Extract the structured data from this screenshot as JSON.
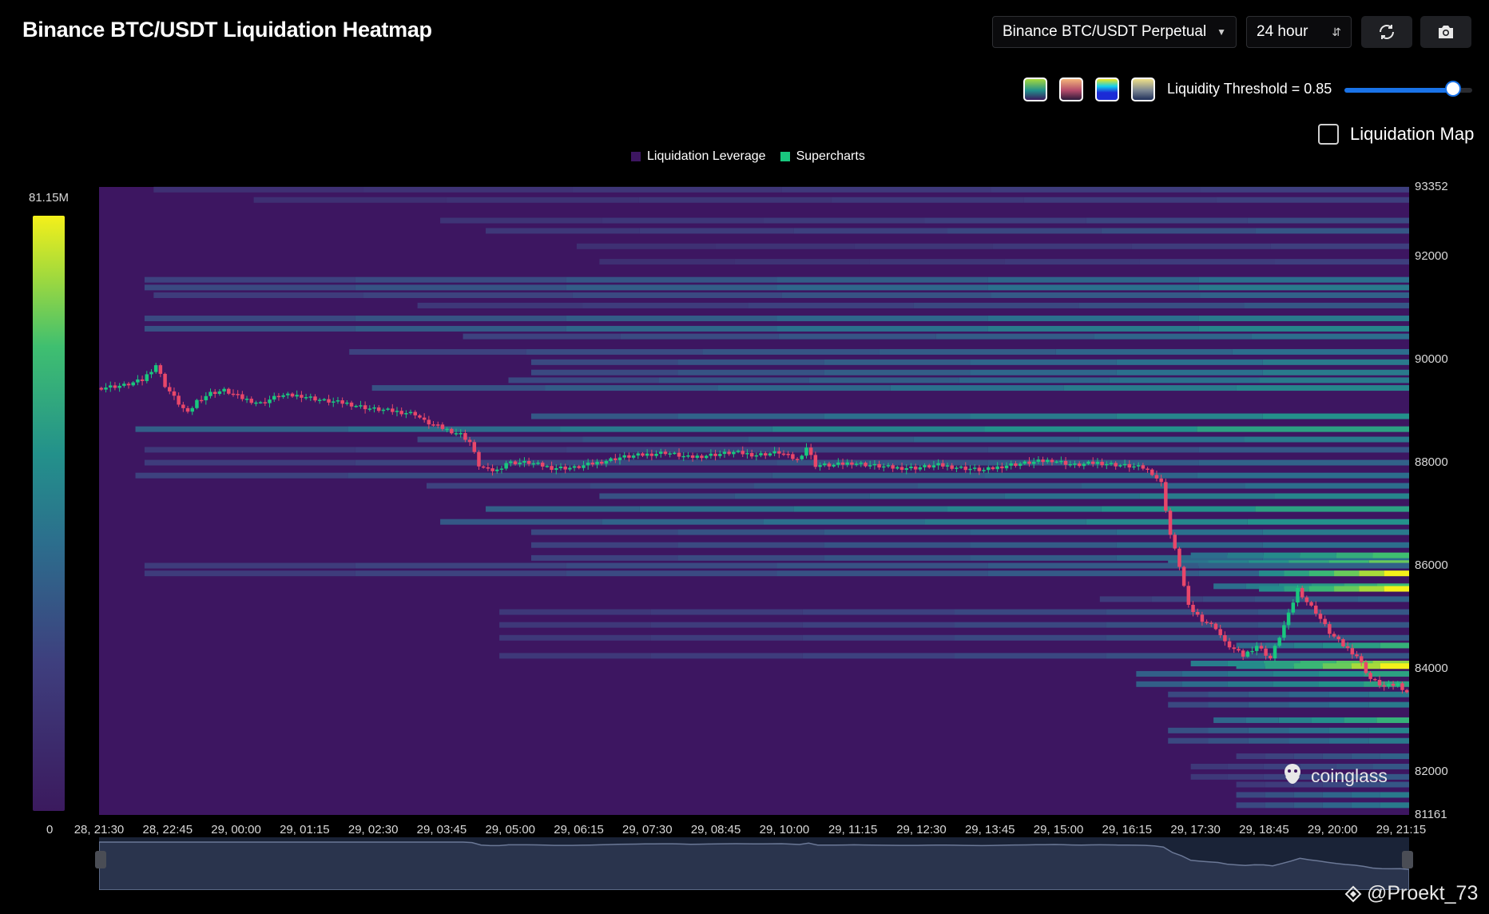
{
  "header": {
    "title": "Binance BTC/USDT Liquidation Heatmap",
    "exchange_select": "Binance BTC/USDT Perpetual",
    "range_select": "24 hour"
  },
  "toolbar": {
    "refresh_icon": "refresh-icon",
    "camera_icon": "camera-icon"
  },
  "palettes": [
    {
      "name": "palette-viridis",
      "colors": [
        "#3b1a5e",
        "#21908c",
        "#a6da3c"
      ]
    },
    {
      "name": "palette-magma",
      "colors": [
        "#2b1a3a",
        "#b24a6a",
        "#f4b47a"
      ]
    },
    {
      "name": "palette-jet",
      "colors": [
        "#1b2bd6",
        "#12d0ef",
        "#f2e81a"
      ]
    },
    {
      "name": "palette-cividis",
      "colors": [
        "#1f2f5a",
        "#7a8592",
        "#efe088"
      ]
    }
  ],
  "threshold": {
    "label": "Liquidity Threshold = 0.85",
    "value": 0.85
  },
  "liquidation_map": {
    "label": "Liquidation Map",
    "checked": false
  },
  "legend": [
    {
      "label": "Liquidation Leverage",
      "color": "#3d1661"
    },
    {
      "label": "Supercharts",
      "color": "#19c77e"
    }
  ],
  "colorscale": {
    "max_label": "81.15M",
    "min_label": "0"
  },
  "y_axis": {
    "ticks": [
      "93352",
      "92000",
      "90000",
      "88000",
      "86000",
      "84000",
      "82000",
      "81161"
    ]
  },
  "x_axis": {
    "ticks": [
      "28, 21:30",
      "28, 22:45",
      "29, 00:00",
      "29, 01:15",
      "29, 02:30",
      "29, 03:45",
      "29, 05:00",
      "29, 06:15",
      "29, 07:30",
      "29, 08:45",
      "29, 10:00",
      "29, 11:15",
      "29, 12:30",
      "29, 13:45",
      "29, 15:00",
      "29, 16:15",
      "29, 17:30",
      "29, 18:45",
      "29, 20:00",
      "29, 21:15"
    ]
  },
  "branding": {
    "logo": "coinglass",
    "watermark": "@Proekt_73"
  },
  "chart_data": {
    "type": "heatmap",
    "ylim": [
      81161,
      93352
    ],
    "x_count": 288,
    "colors": {
      "background": "#3d1661",
      "up_candle": "#19c77e",
      "down_candle": "#e8476a"
    },
    "bands": [
      {
        "price": 93300,
        "start": 12,
        "end": 288,
        "intensity": 0.3
      },
      {
        "price": 93100,
        "start": 34,
        "end": 288,
        "intensity": 0.3
      },
      {
        "price": 92700,
        "start": 75,
        "end": 288,
        "intensity": 0.35
      },
      {
        "price": 92500,
        "start": 85,
        "end": 288,
        "intensity": 0.4
      },
      {
        "price": 92200,
        "start": 105,
        "end": 288,
        "intensity": 0.3
      },
      {
        "price": 91900,
        "start": 110,
        "end": 288,
        "intensity": 0.3
      },
      {
        "price": 91550,
        "start": 10,
        "end": 288,
        "intensity": 0.5
      },
      {
        "price": 91400,
        "start": 10,
        "end": 288,
        "intensity": 0.55
      },
      {
        "price": 91250,
        "start": 12,
        "end": 288,
        "intensity": 0.45
      },
      {
        "price": 91050,
        "start": 70,
        "end": 288,
        "intensity": 0.4
      },
      {
        "price": 90800,
        "start": 10,
        "end": 288,
        "intensity": 0.55
      },
      {
        "price": 90600,
        "start": 10,
        "end": 288,
        "intensity": 0.6
      },
      {
        "price": 90450,
        "start": 80,
        "end": 288,
        "intensity": 0.5
      },
      {
        "price": 90150,
        "start": 55,
        "end": 288,
        "intensity": 0.5
      },
      {
        "price": 89950,
        "start": 95,
        "end": 288,
        "intensity": 0.55
      },
      {
        "price": 89750,
        "start": 95,
        "end": 288,
        "intensity": 0.55
      },
      {
        "price": 89600,
        "start": 90,
        "end": 288,
        "intensity": 0.55
      },
      {
        "price": 89450,
        "start": 60,
        "end": 288,
        "intensity": 0.6
      },
      {
        "price": 88900,
        "start": 95,
        "end": 288,
        "intensity": 0.65
      },
      {
        "price": 88650,
        "start": 8,
        "end": 288,
        "intensity": 0.7
      },
      {
        "price": 88450,
        "start": 70,
        "end": 288,
        "intensity": 0.55
      },
      {
        "price": 88250,
        "start": 10,
        "end": 288,
        "intensity": 0.4
      },
      {
        "price": 88000,
        "start": 10,
        "end": 288,
        "intensity": 0.45
      },
      {
        "price": 87750,
        "start": 8,
        "end": 288,
        "intensity": 0.5
      },
      {
        "price": 87550,
        "start": 72,
        "end": 288,
        "intensity": 0.5
      },
      {
        "price": 87350,
        "start": 110,
        "end": 288,
        "intensity": 0.6
      },
      {
        "price": 87100,
        "start": 85,
        "end": 288,
        "intensity": 0.7
      },
      {
        "price": 86850,
        "start": 75,
        "end": 288,
        "intensity": 0.65
      },
      {
        "price": 86650,
        "start": 95,
        "end": 288,
        "intensity": 0.55
      },
      {
        "price": 86400,
        "start": 95,
        "end": 288,
        "intensity": 0.5
      },
      {
        "price": 86150,
        "start": 95,
        "end": 288,
        "intensity": 0.5
      },
      {
        "price": 86200,
        "start": 240,
        "end": 288,
        "intensity": 0.8
      },
      {
        "price": 86050,
        "start": 235,
        "end": 288,
        "intensity": 0.85
      },
      {
        "price": 86000,
        "start": 10,
        "end": 288,
        "intensity": 0.45
      },
      {
        "price": 85850,
        "start": 10,
        "end": 288,
        "intensity": 0.45
      },
      {
        "price": 85850,
        "start": 255,
        "end": 288,
        "intensity": 1.0
      },
      {
        "price": 85600,
        "start": 245,
        "end": 288,
        "intensity": 0.8
      },
      {
        "price": 85550,
        "start": 255,
        "end": 288,
        "intensity": 1.0
      },
      {
        "price": 85350,
        "start": 220,
        "end": 288,
        "intensity": 0.45
      },
      {
        "price": 85100,
        "start": 88,
        "end": 288,
        "intensity": 0.4
      },
      {
        "price": 84850,
        "start": 88,
        "end": 288,
        "intensity": 0.4
      },
      {
        "price": 84600,
        "start": 88,
        "end": 288,
        "intensity": 0.4
      },
      {
        "price": 84450,
        "start": 250,
        "end": 288,
        "intensity": 0.75
      },
      {
        "price": 84250,
        "start": 88,
        "end": 288,
        "intensity": 0.4
      },
      {
        "price": 84100,
        "start": 240,
        "end": 288,
        "intensity": 0.9
      },
      {
        "price": 84050,
        "start": 250,
        "end": 288,
        "intensity": 1.0
      },
      {
        "price": 83900,
        "start": 228,
        "end": 288,
        "intensity": 0.7
      },
      {
        "price": 83700,
        "start": 228,
        "end": 288,
        "intensity": 0.7
      },
      {
        "price": 83500,
        "start": 235,
        "end": 288,
        "intensity": 0.55
      },
      {
        "price": 83300,
        "start": 235,
        "end": 288,
        "intensity": 0.55
      },
      {
        "price": 83000,
        "start": 245,
        "end": 288,
        "intensity": 0.75
      },
      {
        "price": 82800,
        "start": 235,
        "end": 288,
        "intensity": 0.6
      },
      {
        "price": 82600,
        "start": 235,
        "end": 288,
        "intensity": 0.55
      },
      {
        "price": 82300,
        "start": 250,
        "end": 288,
        "intensity": 0.45
      },
      {
        "price": 82100,
        "start": 240,
        "end": 288,
        "intensity": 0.4
      },
      {
        "price": 81900,
        "start": 240,
        "end": 288,
        "intensity": 0.4
      },
      {
        "price": 81750,
        "start": 250,
        "end": 288,
        "intensity": 0.4
      },
      {
        "price": 81550,
        "start": 250,
        "end": 288,
        "intensity": 0.55
      },
      {
        "price": 81350,
        "start": 250,
        "end": 288,
        "intensity": 0.55
      }
    ],
    "price_path": [
      [
        0,
        89450
      ],
      [
        6,
        89500
      ],
      [
        10,
        89600
      ],
      [
        12,
        89800
      ],
      [
        13,
        89900
      ],
      [
        15,
        89500
      ],
      [
        18,
        89150
      ],
      [
        20,
        88950
      ],
      [
        22,
        89200
      ],
      [
        25,
        89350
      ],
      [
        28,
        89400
      ],
      [
        32,
        89250
      ],
      [
        36,
        89150
      ],
      [
        40,
        89300
      ],
      [
        45,
        89300
      ],
      [
        50,
        89200
      ],
      [
        55,
        89150
      ],
      [
        60,
        89050
      ],
      [
        65,
        89000
      ],
      [
        70,
        88950
      ],
      [
        72,
        88800
      ],
      [
        75,
        88700
      ],
      [
        80,
        88550
      ],
      [
        82,
        88400
      ],
      [
        84,
        87950
      ],
      [
        86,
        87850
      ],
      [
        88,
        87850
      ],
      [
        90,
        88000
      ],
      [
        95,
        88000
      ],
      [
        100,
        87900
      ],
      [
        105,
        87900
      ],
      [
        110,
        88000
      ],
      [
        115,
        88100
      ],
      [
        120,
        88150
      ],
      [
        125,
        88200
      ],
      [
        130,
        88100
      ],
      [
        135,
        88150
      ],
      [
        140,
        88200
      ],
      [
        145,
        88150
      ],
      [
        150,
        88200
      ],
      [
        154,
        88050
      ],
      [
        156,
        88300
      ],
      [
        158,
        87950
      ],
      [
        162,
        87950
      ],
      [
        166,
        88000
      ],
      [
        170,
        87950
      ],
      [
        175,
        87900
      ],
      [
        180,
        87900
      ],
      [
        185,
        87950
      ],
      [
        190,
        87900
      ],
      [
        195,
        87850
      ],
      [
        200,
        87950
      ],
      [
        205,
        88000
      ],
      [
        210,
        88050
      ],
      [
        215,
        87950
      ],
      [
        220,
        88000
      ],
      [
        225,
        87950
      ],
      [
        230,
        87900
      ],
      [
        232,
        87800
      ],
      [
        234,
        87600
      ],
      [
        236,
        86600
      ],
      [
        238,
        86000
      ],
      [
        240,
        85200
      ],
      [
        243,
        84950
      ],
      [
        246,
        84800
      ],
      [
        248,
        84500
      ],
      [
        252,
        84250
      ],
      [
        255,
        84450
      ],
      [
        258,
        84200
      ],
      [
        262,
        85050
      ],
      [
        264,
        85550
      ],
      [
        266,
        85300
      ],
      [
        268,
        85100
      ],
      [
        271,
        84700
      ],
      [
        274,
        84450
      ],
      [
        277,
        84250
      ],
      [
        280,
        83800
      ],
      [
        283,
        83650
      ],
      [
        286,
        83700
      ],
      [
        288,
        83550
      ]
    ]
  }
}
